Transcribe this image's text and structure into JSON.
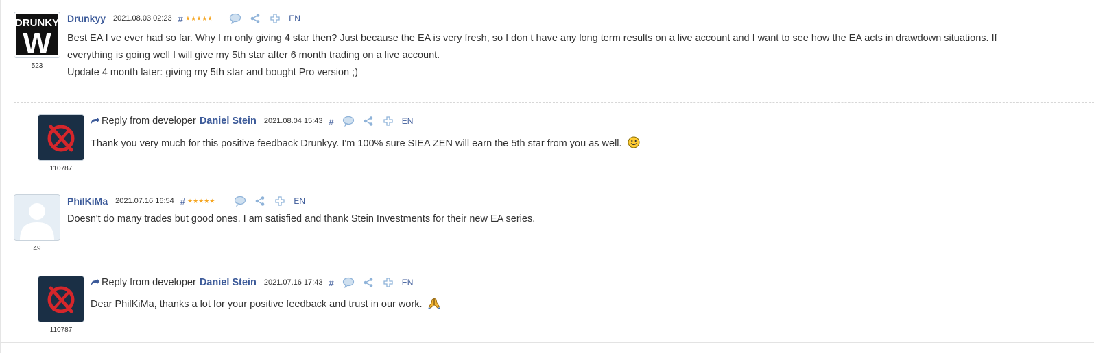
{
  "reviews": [
    {
      "author": "Drunkyy",
      "date": "2021.08.03 02:23",
      "hash": "#",
      "stars": "★★★★★",
      "rating_count": "523",
      "lang": "EN",
      "avatar_text_top": "DRUNKY",
      "avatar_text_bottom": "W",
      "text_lines": [
        "Best EA I ve ever had so far. Why I m only giving 4 star then? Just because the EA is very fresh, so I don t have any long term results on a live account and I want to see how the EA acts in drawdown situations. If",
        "everything is going well I will give my 5th star after 6 month trading on a live account.",
        "Update 4 month later: giving my 5th star and bought Pro version ;)"
      ],
      "reply": {
        "label": "Reply from developer",
        "developer": "Daniel Stein",
        "date": "2021.08.04 15:43",
        "hash": "#",
        "lang": "EN",
        "rating_count": "110787",
        "text": "Thank you very much for this positive feedback Drunkyy. I'm 100% sure SIEA ZEN will earn the 5th star from you as well.",
        "emoji": "smiley-emoji"
      }
    },
    {
      "author": "PhilKiMa",
      "date": "2021.07.16 16:54",
      "hash": "#",
      "stars": "★★★★★",
      "rating_count": "49",
      "lang": "EN",
      "text_lines": [
        "Doesn't do many trades but good ones. I am satisfied and thank Stein Investments for their new EA series."
      ],
      "reply": {
        "label": "Reply from developer",
        "developer": "Daniel Stein",
        "date": "2021.07.16 17:43",
        "hash": "#",
        "lang": "EN",
        "rating_count": "110787",
        "text": "Dear PhilKiMa, thanks a lot for your positive feedback and trust in our work.",
        "emoji": "folded-hands-emoji"
      }
    }
  ],
  "colors": {
    "link": "#3c5a99",
    "star": "#f5a623",
    "icon": "#8fb3d9",
    "logo_bg": "#1a2f45",
    "logo_red": "#d6262b"
  },
  "icons": [
    "comment-icon",
    "share-icon",
    "plus-icon"
  ]
}
